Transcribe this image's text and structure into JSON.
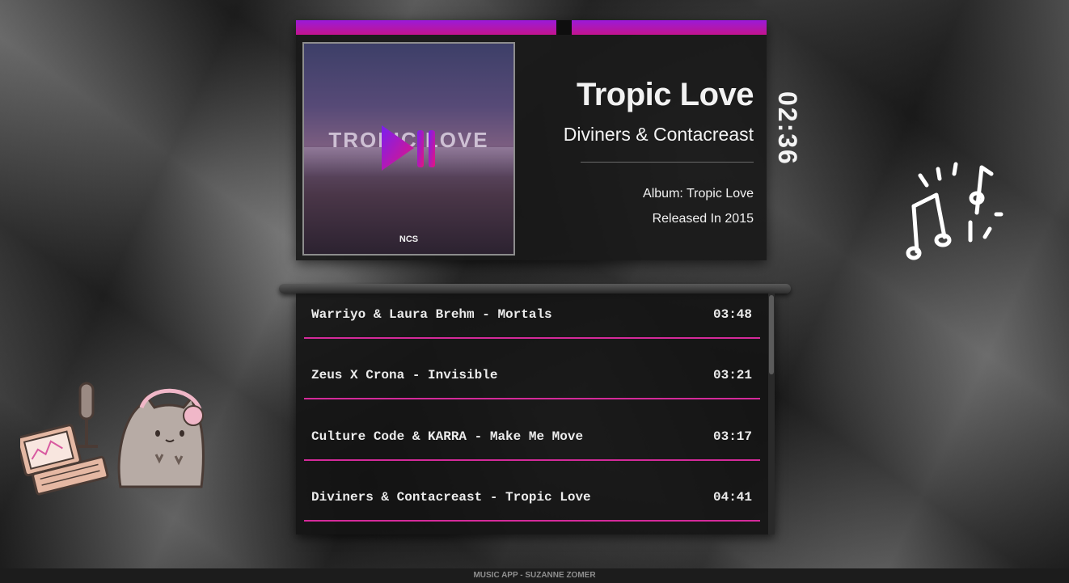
{
  "now_playing": {
    "title": "Tropic Love",
    "artist": "Diviners & Contacreast",
    "album": "Album: Tropic Love",
    "released": "Released In 2015",
    "elapsed_time": "02:36",
    "progress_fraction": 0.55,
    "cover_text": "TROPIC LOVE",
    "cover_label": "NCS"
  },
  "playlist": {
    "tracks": [
      {
        "name": "Warriyo & Laura Brehm - Mortals",
        "duration": "03:48"
      },
      {
        "name": "Zeus X Crona - Invisible",
        "duration": "03:21"
      },
      {
        "name": "Culture Code & KARRA - Make Me Move",
        "duration": "03:17"
      },
      {
        "name": "Diviners & Contacreast - Tropic Love",
        "duration": "04:41"
      }
    ]
  },
  "footer": {
    "text": "MUSIC APP - SUZANNE ZOMER"
  },
  "colors": {
    "accent_purple": "#9b1ad8",
    "accent_pink": "#d42a9a"
  },
  "icons": [
    "play-pause-icon",
    "music-notes-icon",
    "pusheen-cat-icon"
  ]
}
